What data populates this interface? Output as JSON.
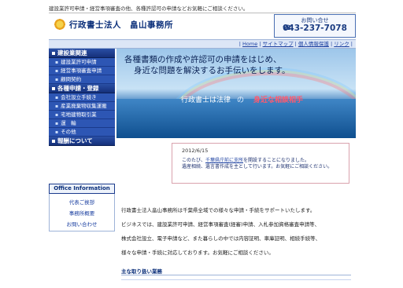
{
  "topline": "建設業許可申請・経営事項審査の他、各種許認可の申請などお気軽にご相談ください。",
  "header": {
    "logo_text": "行政書士法人　畠山事務所",
    "phone_label": "お問い合せ",
    "phone_number": "043-237-7078",
    "phone_icon": "phone-icon"
  },
  "nav_links": [
    "Home",
    "サイトマップ",
    "個人情報保護",
    "リンク"
  ],
  "sidebar": {
    "sections": [
      {
        "title": "建設業関連",
        "items": [
          "建設業許可申請",
          "経営事項審査申請",
          "顧問契約"
        ]
      },
      {
        "title": "各種申請・登録",
        "items": [
          "会社設立手続き",
          "産業廃棄物収集運搬",
          "宅地建物取引業",
          "運　輸",
          "その他"
        ]
      },
      {
        "title": "報酬について",
        "items": []
      }
    ],
    "info_title": "Office Information",
    "info_links": [
      "代表ご挨拶",
      "事務所概要",
      "お問い合わせ"
    ]
  },
  "hero": {
    "line1": "各種書類の作成や許認可の申請をはじめ、",
    "line2": "身近な問題を解決するお手伝いをします。",
    "cap_left": "行政書士は法律",
    "cap_mid": "の",
    "cap_right": "身近な相談相手"
  },
  "news": {
    "date": "2012/6/15",
    "p1_pre": "このたび、",
    "p1_link": "千葉県庁前に支所",
    "p1_post": "を開設することになりました。",
    "p2": "遺産相続、遺言書作成を主として行います。お気軽にご相談ください。"
  },
  "body": {
    "r1": "行政書士法人畠山事務所は千葉県全域での様々な申請・手続をサポートいたします。",
    "r2": "ビジネスでは、建設業許可申請、経営事項審査(経審)申請、入札参加資格審査申請等、",
    "r3": "株式会社設立、電子申請など、また暮らしの中では内容証明、車庫証明、相続手続等、",
    "r4": "様々な申請・手続に対応しております。お気軽にご相談ください。",
    "svc_title": "主な取り扱い業務"
  }
}
